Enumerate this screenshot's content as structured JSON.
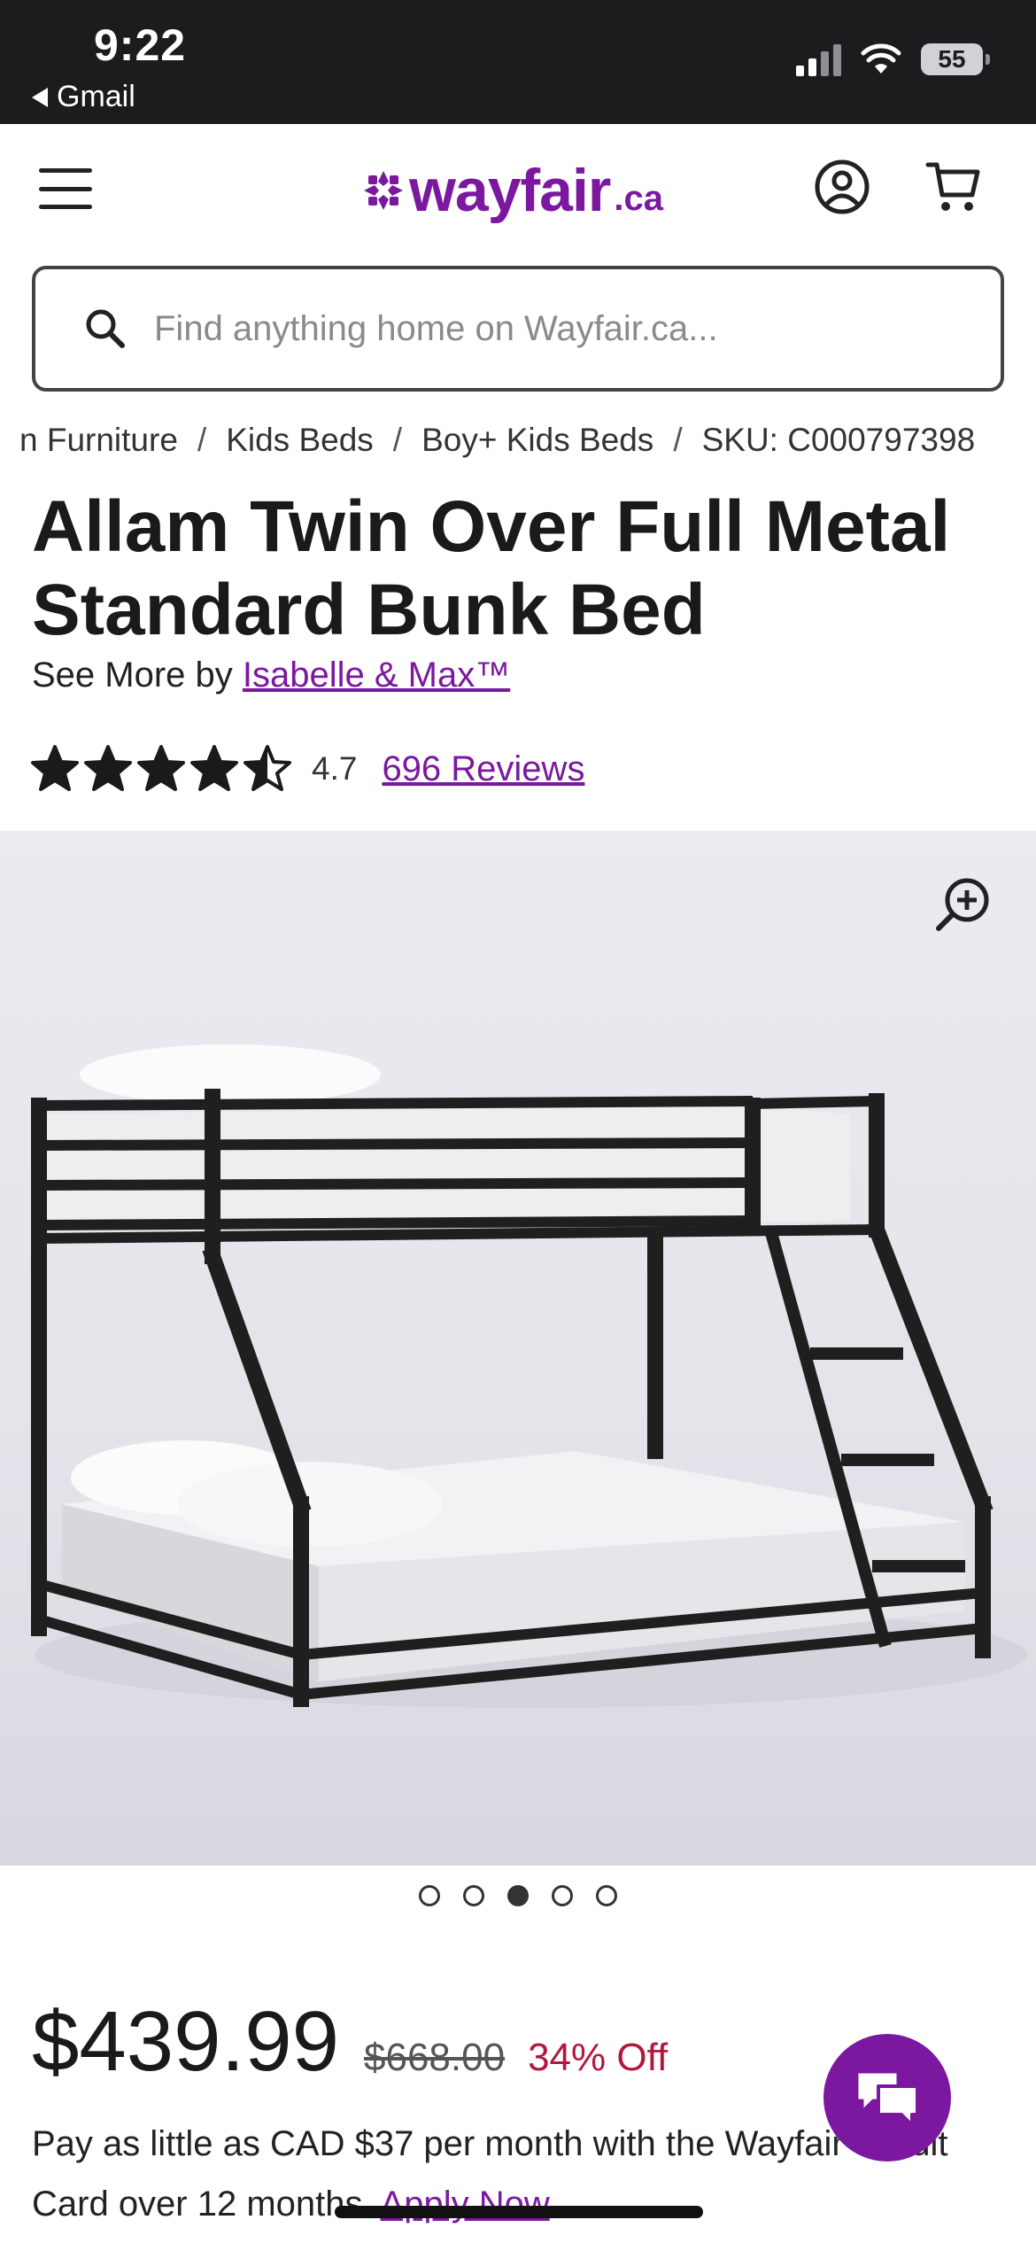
{
  "status_bar": {
    "time": "9:22",
    "back_label": "Gmail",
    "battery": "55"
  },
  "header": {
    "logo_text": "wayfair",
    "logo_tld": ".ca",
    "brand_color": "#7b189f"
  },
  "search": {
    "placeholder": "Find anything home on Wayfair.ca..."
  },
  "breadcrumb": {
    "items": [
      "n Furniture",
      "Kids Beds",
      "Boy+ Kids Beds",
      "SKU: C000797398"
    ],
    "separator": "/"
  },
  "product": {
    "title": "Allam Twin Over Full Metal Standard Bunk Bed",
    "see_more_prefix": "See More by",
    "brand": "Isabelle & Max™",
    "rating": "4.7",
    "rating_value": 4.7,
    "reviews_label": "696 Reviews"
  },
  "gallery": {
    "image_count": 5,
    "active_index": 2
  },
  "pricing": {
    "price": "$439.99",
    "was_price": "$668.00",
    "discount": "34% Off",
    "discount_color": "#b3173c"
  },
  "financing": {
    "text": "Pay as little as CAD $37 per month with the Wayfair Credit Card over 12 months.",
    "apply_label": "Apply Now"
  },
  "icons": [
    "menu-icon",
    "account-icon",
    "cart-icon",
    "search-icon",
    "star-icon",
    "zoom-in-icon",
    "chat-icon"
  ]
}
